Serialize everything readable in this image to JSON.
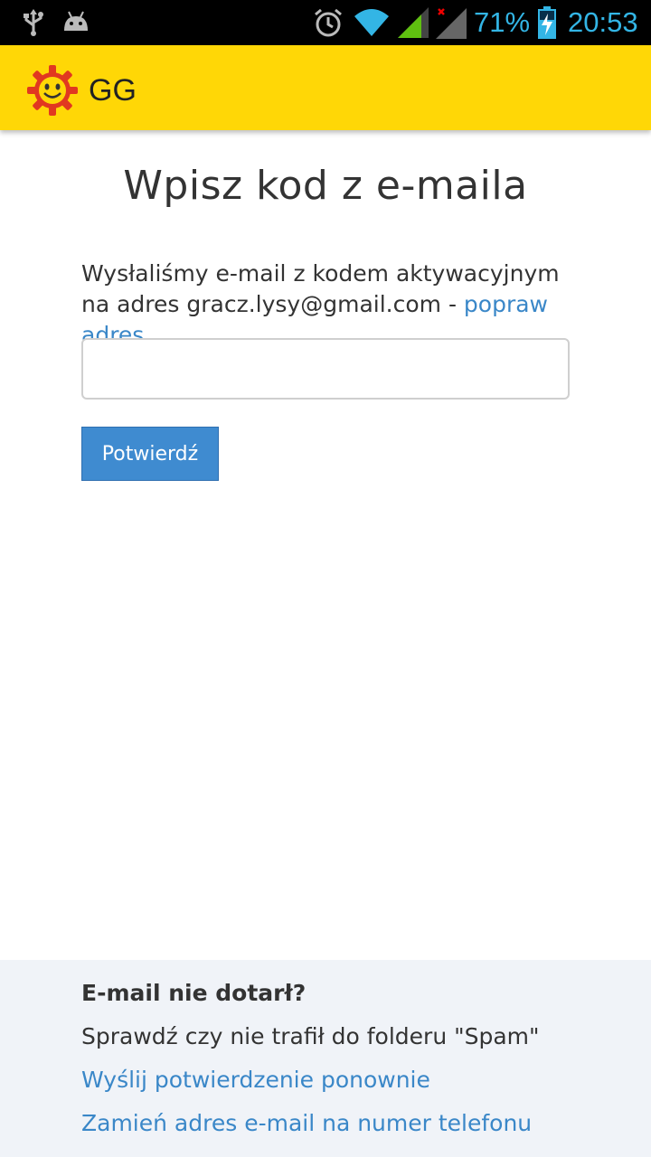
{
  "status_bar": {
    "battery_percent": "71%",
    "time": "20:53",
    "icons": [
      "usb-icon",
      "android-icon",
      "alarm-icon",
      "wifi-icon",
      "signal-icon",
      "signal-no-data-icon",
      "battery-charging-icon"
    ]
  },
  "app_bar": {
    "title": "GG",
    "logo": "gg-sun-logo"
  },
  "main": {
    "title": "Wpisz kod z e-maila",
    "info_text": "Wysłaliśmy e-mail z kodem aktywacyjnym na adres gracz.lysy@gmail.com - ",
    "fix_address_link": "popraw adres",
    "code_input_value": "",
    "confirm_button": "Potwierdź"
  },
  "footer": {
    "heading": "E-mail nie dotarł?",
    "spam_hint": "Sprawdź czy nie trafił do folderu \"Spam\"",
    "resend_link": "Wyślij potwierdzenie ponownie",
    "change_to_phone_link": "Zamień adres e-mail na numer telefonu"
  },
  "colors": {
    "app_bar": "#ffd706",
    "link": "#3a87c8",
    "button": "#3f8bd0",
    "footer_bg": "#f0f3f8",
    "status_text": "#33b5e5"
  }
}
